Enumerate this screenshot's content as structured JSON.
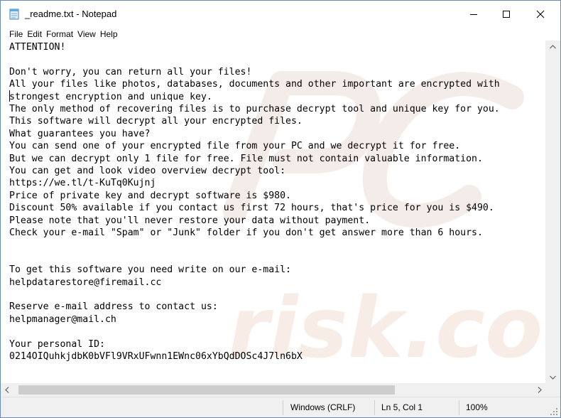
{
  "window": {
    "title": "_readme.txt - Notepad",
    "icons": {
      "app": "notepad-icon",
      "minimize": "minimize-icon",
      "maximize": "maximize-icon",
      "close": "close-icon"
    }
  },
  "menu": {
    "items": [
      "File",
      "Edit",
      "Format",
      "View",
      "Help"
    ]
  },
  "document": {
    "lines": [
      "ATTENTION!",
      "",
      "Don't worry, you can return all your files!",
      "All your files like photos, databases, documents and other important are encrypted with",
      "strongest encryption and unique key.",
      "The only method of recovering files is to purchase decrypt tool and unique key for you.",
      "This software will decrypt all your encrypted files.",
      "What guarantees you have?",
      "You can send one of your encrypted file from your PC and we decrypt it for free.",
      "But we can decrypt only 1 file for free. File must not contain valuable information.",
      "You can get and look video overview decrypt tool:",
      "https://we.tl/t-KuTq0Kujnj",
      "Price of private key and decrypt software is $980.",
      "Discount 50% available if you contact us first 72 hours, that's price for you is $490.",
      "Please note that you'll never restore your data without payment.",
      "Check your e-mail \"Spam\" or \"Junk\" folder if you don't get answer more than 6 hours.",
      "",
      "",
      "To get this software you need write on our e-mail:",
      "helpdatarestore@firemail.cc",
      "",
      "Reserve e-mail address to contact us:",
      "helpmanager@mail.ch",
      "",
      "Your personal ID:",
      "0214OIQuhkjdbK0bVFl9VRxUFwnn1EWnc06xYbQdDOSc4J7ln6bX"
    ]
  },
  "watermark": {
    "text": "risk.com"
  },
  "status": {
    "line_ending": "Windows (CRLF)",
    "cursor": "Ln 5, Col 1",
    "zoom": "100%"
  },
  "colors": {
    "window_border": "#6a8ab8",
    "chrome_background": "#f0f0f0",
    "scroll_thumb": "#cdcdcd",
    "watermark": "#f7ece6"
  }
}
